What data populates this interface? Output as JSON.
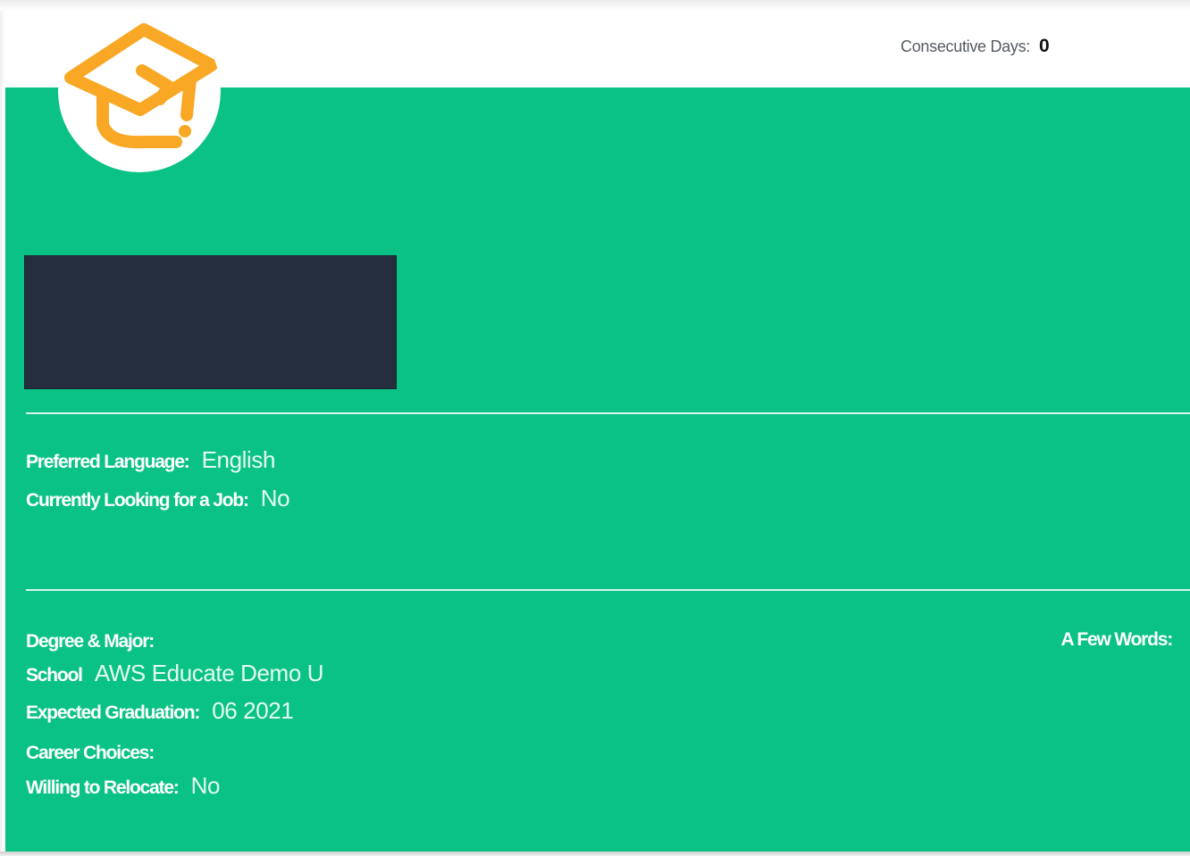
{
  "header": {
    "consecutive_label": "Consecutive Days:",
    "consecutive_value": "0"
  },
  "avatar": {
    "icon": "graduation-cap-icon",
    "icon_color": "#f9a826"
  },
  "colors": {
    "panel": "#0ac286",
    "name_block": "#242e3e"
  },
  "profile": {
    "preferred_language_label": "Preferred Language:",
    "preferred_language_value": "English",
    "looking_for_job_label": "Currently Looking for a Job:",
    "looking_for_job_value": "No",
    "degree_major_label": "Degree & Major:",
    "degree_major_value": "",
    "school_label": "School",
    "school_value": "AWS Educate Demo U",
    "graduation_label": "Expected Graduation:",
    "graduation_value": "06 2021",
    "career_choices_label": "Career Choices:",
    "career_choices_value": "",
    "relocate_label": "Willing to Relocate:",
    "relocate_value": "No",
    "few_words_label": "A Few Words:"
  }
}
